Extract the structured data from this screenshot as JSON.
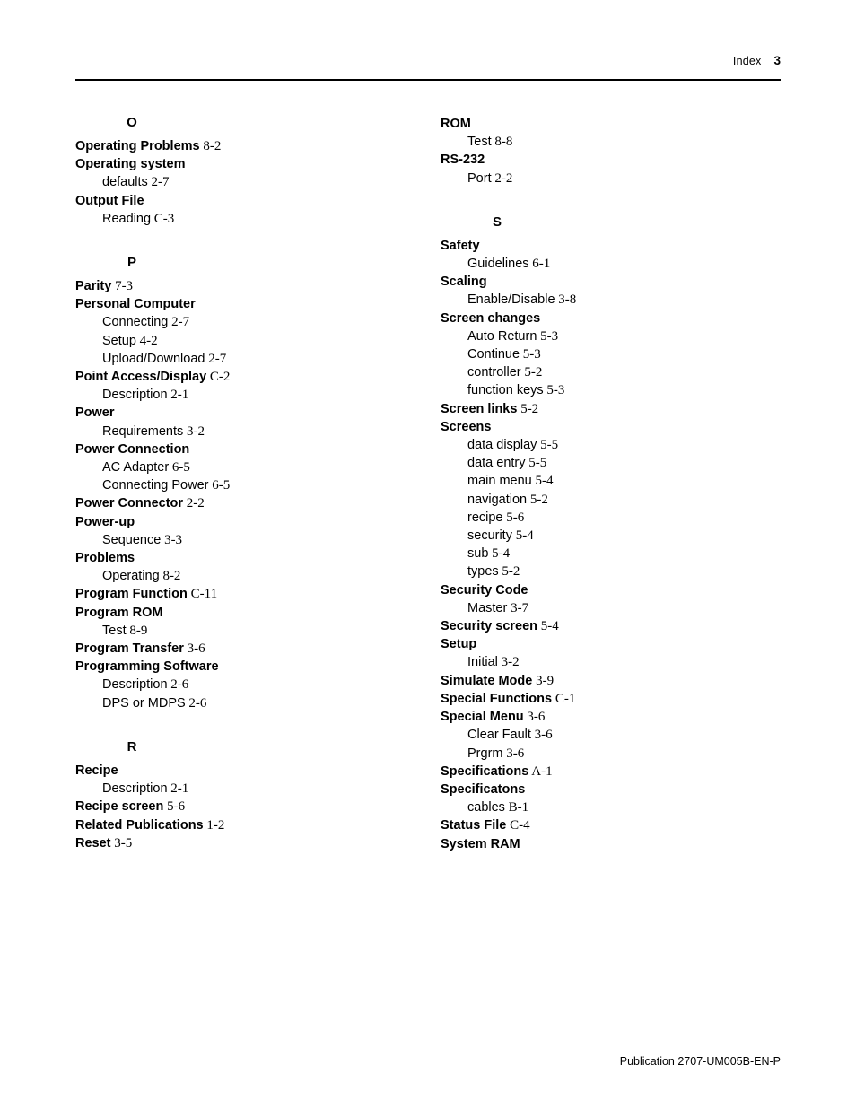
{
  "header": {
    "label": "Index",
    "page_number": "3"
  },
  "footer": {
    "publication": "Publication 2707-UM005B-EN-P"
  },
  "left_column": {
    "sections": [
      {
        "letter": "O",
        "entries": [
          {
            "level": "main",
            "term": "Operating Problems",
            "locator": "8-2"
          },
          {
            "level": "main",
            "term": "Operating system",
            "locator": ""
          },
          {
            "level": "sub",
            "term": "defaults",
            "locator": "2-7"
          },
          {
            "level": "main",
            "term": "Output File",
            "locator": ""
          },
          {
            "level": "sub",
            "term": "Reading",
            "locator": "C-3"
          }
        ]
      },
      {
        "letter": "P",
        "entries": [
          {
            "level": "main",
            "term": "Parity",
            "locator": "7-3"
          },
          {
            "level": "main",
            "term": "Personal Computer",
            "locator": ""
          },
          {
            "level": "sub",
            "term": "Connecting",
            "locator": "2-7"
          },
          {
            "level": "sub",
            "term": "Setup",
            "locator": "4-2"
          },
          {
            "level": "sub",
            "term": "Upload/Download",
            "locator": "2-7"
          },
          {
            "level": "main",
            "term": "Point Access/Display",
            "locator": "C-2"
          },
          {
            "level": "sub",
            "term": "Description",
            "locator": "2-1"
          },
          {
            "level": "main",
            "term": "Power",
            "locator": ""
          },
          {
            "level": "sub",
            "term": "Requirements",
            "locator": "3-2"
          },
          {
            "level": "main",
            "term": "Power Connection",
            "locator": ""
          },
          {
            "level": "sub",
            "term": "AC Adapter",
            "locator": "6-5"
          },
          {
            "level": "sub",
            "term": "Connecting Power",
            "locator": "6-5"
          },
          {
            "level": "main",
            "term": "Power Connector",
            "locator": "2-2"
          },
          {
            "level": "main",
            "term": "Power-up",
            "locator": ""
          },
          {
            "level": "sub",
            "term": "Sequence",
            "locator": "3-3"
          },
          {
            "level": "main",
            "term": "Problems",
            "locator": ""
          },
          {
            "level": "sub",
            "term": "Operating",
            "locator": "8-2"
          },
          {
            "level": "main",
            "term": "Program Function",
            "locator": "C-11"
          },
          {
            "level": "main",
            "term": "Program ROM",
            "locator": ""
          },
          {
            "level": "sub",
            "term": "Test",
            "locator": "8-9"
          },
          {
            "level": "main",
            "term": "Program Transfer",
            "locator": "3-6"
          },
          {
            "level": "main",
            "term": "Programming Software",
            "locator": ""
          },
          {
            "level": "sub",
            "term": "Description",
            "locator": "2-6"
          },
          {
            "level": "sub",
            "term": "DPS or MDPS",
            "locator": "2-6"
          }
        ]
      },
      {
        "letter": "R",
        "entries": [
          {
            "level": "main",
            "term": "Recipe",
            "locator": ""
          },
          {
            "level": "sub",
            "term": "Description",
            "locator": "2-1"
          },
          {
            "level": "main",
            "term": "Recipe screen",
            "locator": "5-6"
          },
          {
            "level": "main",
            "term": "Related Publications",
            "locator": "1-2"
          },
          {
            "level": "main",
            "term": "Reset",
            "locator": "3-5"
          }
        ]
      }
    ]
  },
  "right_column": {
    "sections": [
      {
        "letter": "",
        "entries": [
          {
            "level": "main",
            "term": "ROM",
            "locator": ""
          },
          {
            "level": "sub",
            "term": "Test",
            "locator": "8-8"
          },
          {
            "level": "main",
            "term": "RS-232",
            "locator": ""
          },
          {
            "level": "sub",
            "term": "Port",
            "locator": "2-2"
          }
        ]
      },
      {
        "letter": "S",
        "entries": [
          {
            "level": "main",
            "term": "Safety",
            "locator": ""
          },
          {
            "level": "sub",
            "term": "Guidelines",
            "locator": "6-1"
          },
          {
            "level": "main",
            "term": "Scaling",
            "locator": ""
          },
          {
            "level": "sub",
            "term": "Enable/Disable",
            "locator": "3-8"
          },
          {
            "level": "main",
            "term": "Screen changes",
            "locator": ""
          },
          {
            "level": "sub",
            "term": "Auto Return",
            "locator": "5-3"
          },
          {
            "level": "sub",
            "term": "Continue",
            "locator": "5-3"
          },
          {
            "level": "sub",
            "term": "controller",
            "locator": "5-2"
          },
          {
            "level": "sub",
            "term": "function keys",
            "locator": "5-3"
          },
          {
            "level": "main",
            "term": "Screen links",
            "locator": "5-2"
          },
          {
            "level": "main",
            "term": "Screens",
            "locator": ""
          },
          {
            "level": "sub",
            "term": "data display",
            "locator": "5-5"
          },
          {
            "level": "sub",
            "term": "data entry",
            "locator": "5-5"
          },
          {
            "level": "sub",
            "term": "main menu",
            "locator": "5-4"
          },
          {
            "level": "sub",
            "term": "navigation",
            "locator": "5-2"
          },
          {
            "level": "sub",
            "term": "recipe",
            "locator": "5-6"
          },
          {
            "level": "sub",
            "term": "security",
            "locator": "5-4"
          },
          {
            "level": "sub",
            "term": "sub",
            "locator": "5-4"
          },
          {
            "level": "sub",
            "term": "types",
            "locator": "5-2"
          },
          {
            "level": "main",
            "term": "Security Code",
            "locator": ""
          },
          {
            "level": "sub",
            "term": "Master",
            "locator": "3-7"
          },
          {
            "level": "main",
            "term": "Security screen",
            "locator": "5-4"
          },
          {
            "level": "main",
            "term": "Setup",
            "locator": ""
          },
          {
            "level": "sub",
            "term": "Initial",
            "locator": "3-2"
          },
          {
            "level": "main",
            "term": "Simulate Mode",
            "locator": "3-9"
          },
          {
            "level": "main",
            "term": "Special Functions",
            "locator": "C-1"
          },
          {
            "level": "main",
            "term": "Special Menu",
            "locator": "3-6"
          },
          {
            "level": "sub",
            "term": "Clear Fault",
            "locator": "3-6"
          },
          {
            "level": "sub",
            "term": "Prgrm",
            "locator": "3-6"
          },
          {
            "level": "main",
            "term": "Specifications",
            "locator": "A-1"
          },
          {
            "level": "main",
            "term": "Specificatons",
            "locator": ""
          },
          {
            "level": "sub",
            "term": "cables",
            "locator": "B-1"
          },
          {
            "level": "main",
            "term": "Status File",
            "locator": "C-4"
          },
          {
            "level": "main",
            "term": "System RAM",
            "locator": ""
          }
        ]
      }
    ]
  }
}
